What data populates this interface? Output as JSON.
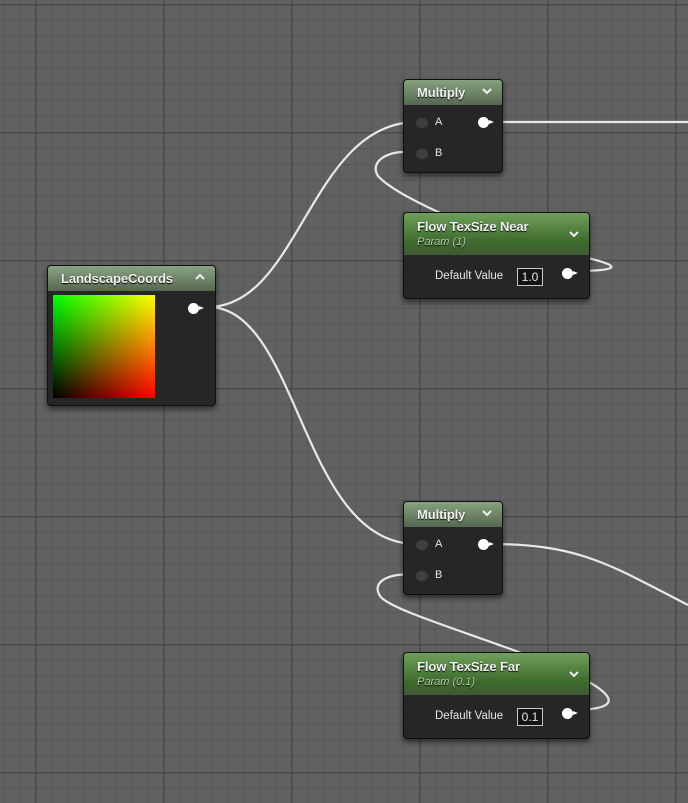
{
  "nodes": {
    "multiply_top": {
      "title": "Multiply",
      "pins": {
        "a": "A",
        "b": "B"
      }
    },
    "flow_near": {
      "title": "Flow TexSize Near",
      "subtitle": "Param (1)",
      "default_label": "Default Value",
      "default_value": "1.0"
    },
    "landscape_coords": {
      "title": "LandscapeCoords"
    },
    "multiply_bottom": {
      "title": "Multiply",
      "pins": {
        "a": "A",
        "b": "B"
      }
    },
    "flow_far": {
      "title": "Flow TexSize Far",
      "subtitle": "Param (0.1)",
      "default_label": "Default Value",
      "default_value": "0.1"
    }
  },
  "colors": {
    "graph_background": "#616161",
    "wire": "#e8e8e8",
    "math_header": "#6c8466",
    "param_header": "#4f7f3c",
    "node_body": "#252625"
  },
  "icons": {
    "collapse_down": "chevron-down-icon",
    "collapse_up": "chevron-up-icon"
  }
}
